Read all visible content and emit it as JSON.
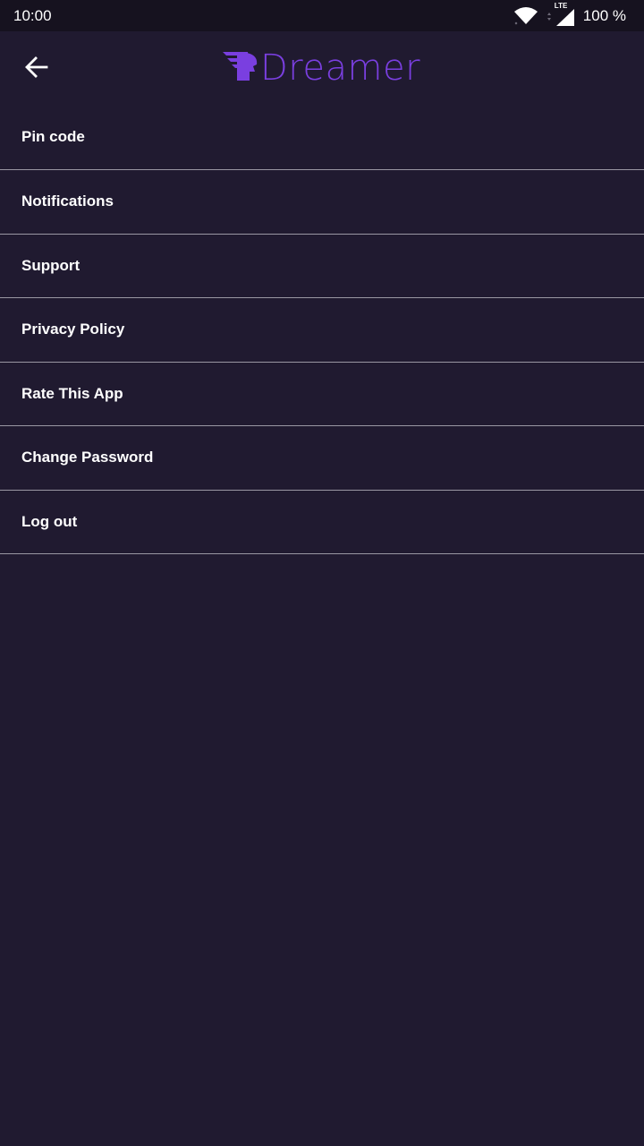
{
  "status_bar": {
    "time": "10:00",
    "network_label": "LTE",
    "battery": "100 %",
    "icons": [
      "wifi-icon",
      "signal-icon"
    ]
  },
  "header": {
    "back_icon": "arrow-left-icon",
    "logo_text": "Dreamer",
    "logo_color": "#7a3fe0"
  },
  "menu": {
    "items": [
      {
        "label": "Pin code"
      },
      {
        "label": "Notifications"
      },
      {
        "label": "Support"
      },
      {
        "label": "Privacy Policy"
      },
      {
        "label": "Rate This App"
      },
      {
        "label": "Change Password"
      },
      {
        "label": "Log out"
      }
    ]
  },
  "colors": {
    "background": "#201a30",
    "status_bar": "#16121f",
    "divider": "#9a97a3",
    "text": "#ffffff"
  }
}
